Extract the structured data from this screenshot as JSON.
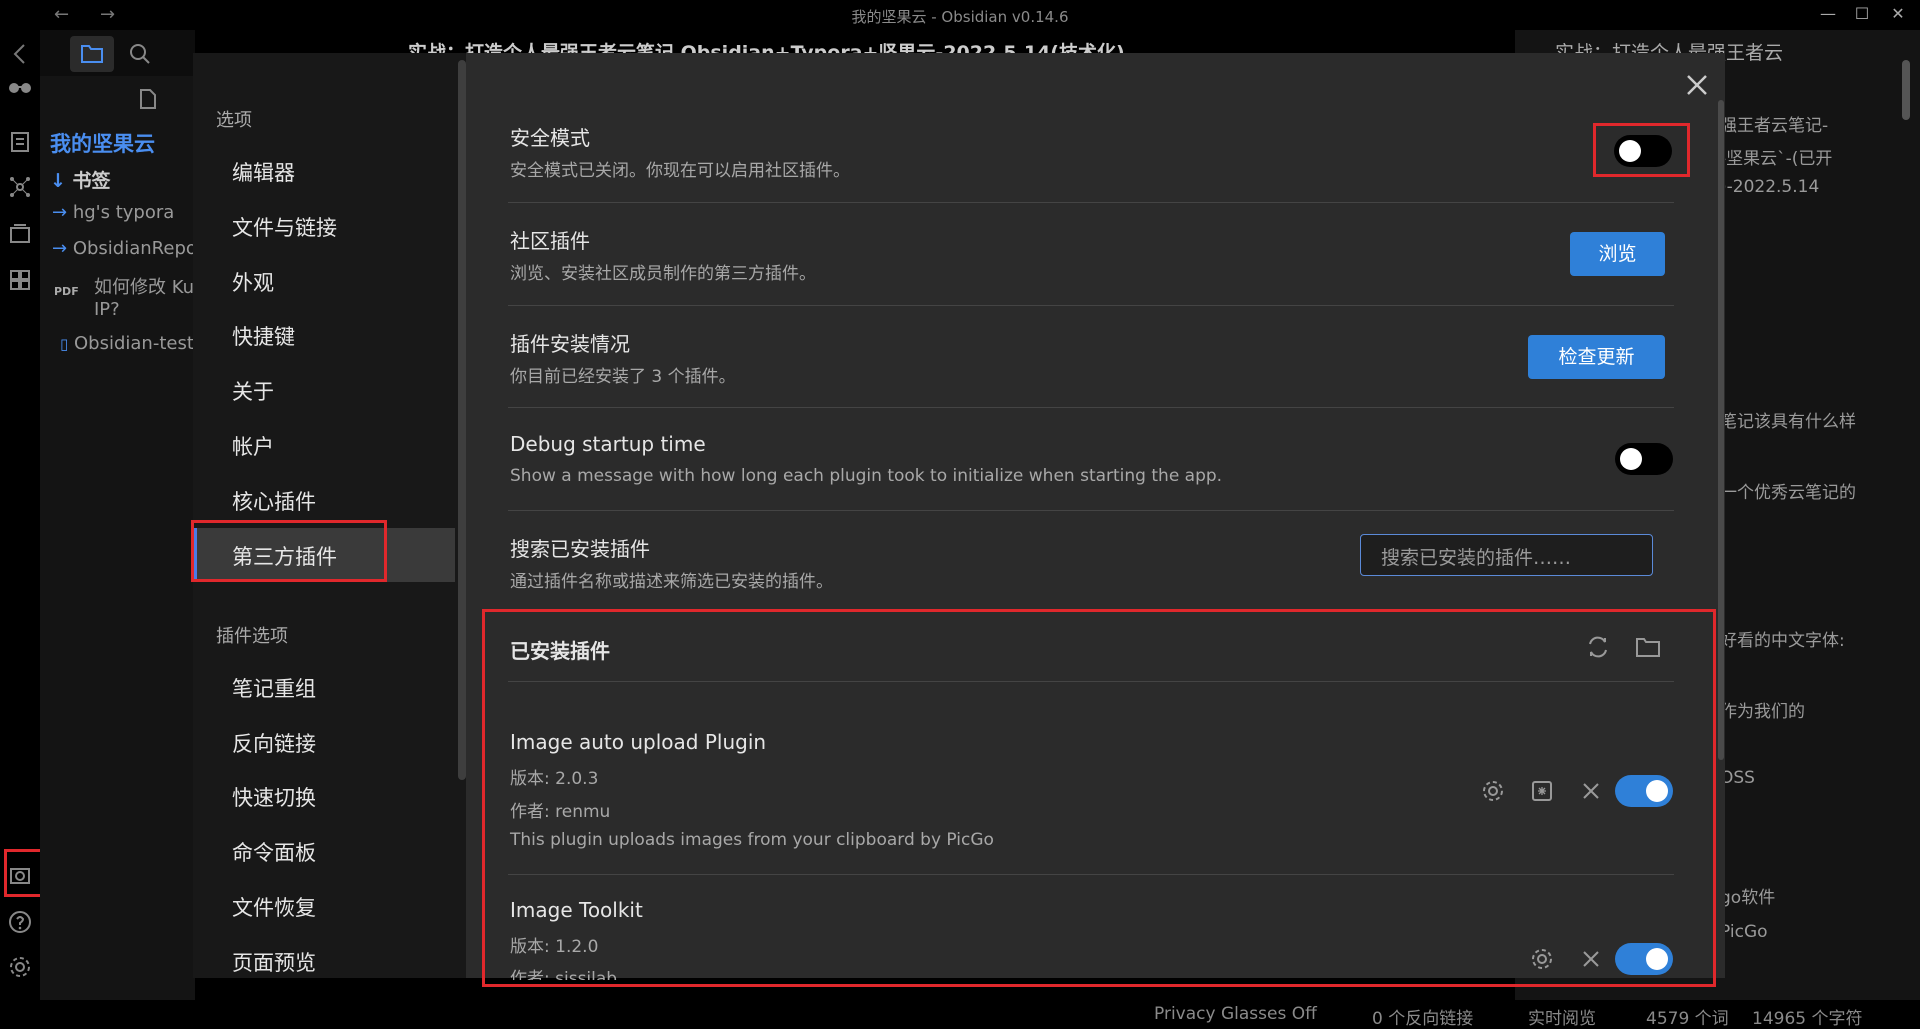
{
  "window": {
    "title": "我的坚果云 - Obsidian v0.14.6",
    "minimize": "—",
    "maximize": "☐",
    "close": "✕",
    "nav_back": "←",
    "nav_forward": "→"
  },
  "file_explorer": {
    "vault_name": "我的坚果云",
    "bookmarks_label": "书签",
    "items": [
      {
        "label": "hg's typora",
        "type": "folder"
      },
      {
        "label": "ObsidianRepos",
        "type": "folder"
      },
      {
        "label": "如何修改 Kubernetes",
        "label2": "IP?",
        "type": "pdf",
        "badge": "PDF"
      },
      {
        "label": "Obsidian-test",
        "type": "file"
      }
    ]
  },
  "editor_tab": {
    "title": "实战：打造个人最强王者云笔记 Obsidian+Typora+坚果云-2022.5.14(技术化)"
  },
  "right_pane": {
    "tab_title": "实战：打造个人最强王者云",
    "lines": [
      "强王者云笔记-",
      "-坚果云`-(已开",
      ")-2022.5.14",
      "笔记该具有什么样",
      "一个优秀云笔记的",
      "好看的中文字体:",
      "作为我们的",
      "OSS",
      "go软件",
      "PicGo"
    ]
  },
  "status_bar": {
    "privacy": "Privacy Glasses Off",
    "backlinks": "0 个反向链接",
    "mode": "实时阅览",
    "words": "4579 个词",
    "chars": "14965 个字符"
  },
  "settings": {
    "sidebar": {
      "options_header": "选项",
      "options": [
        "编辑器",
        "文件与链接",
        "外观",
        "快捷键",
        "关于",
        "帐户",
        "核心插件",
        "第三方插件"
      ],
      "active": "第三方插件",
      "plugin_options_header": "插件选项",
      "plugin_options": [
        "笔记重组",
        "反向链接",
        "快速切换",
        "命令面板",
        "文件恢复",
        "页面预览"
      ]
    },
    "rows": {
      "safe_mode": {
        "name": "安全模式",
        "desc": "安全模式已关闭。你现在可以启用社区插件。",
        "enabled": false
      },
      "community": {
        "name": "社区插件",
        "desc": "浏览、安装社区成员制作的第三方插件。",
        "button": "浏览"
      },
      "installed_status": {
        "name": "插件安装情况",
        "desc": "你目前已经安装了 3 个插件。",
        "button": "检查更新"
      },
      "debug": {
        "name": "Debug startup time",
        "desc": "Show a message with how long each plugin took to initialize when starting the app.",
        "enabled": false
      },
      "search": {
        "name": "搜索已安装插件",
        "desc": "通过插件名称或描述来筛选已安装的插件。",
        "placeholder": "搜索已安装的插件……"
      }
    },
    "installed_header": "已安装插件",
    "plugins": [
      {
        "name": "Image auto upload Plugin",
        "version": "版本: 2.0.3",
        "author": "作者: renmu",
        "desc": "This plugin uploads images from your clipboard by PicGo",
        "enabled": true
      },
      {
        "name": "Image Toolkit",
        "version": "版本: 1.2.0",
        "author": "作者: sissilab",
        "enabled": true
      }
    ]
  },
  "colors": {
    "accent": "#2f80d8",
    "highlight_red": "#e0282c",
    "vault_blue": "#4a8ef0"
  }
}
